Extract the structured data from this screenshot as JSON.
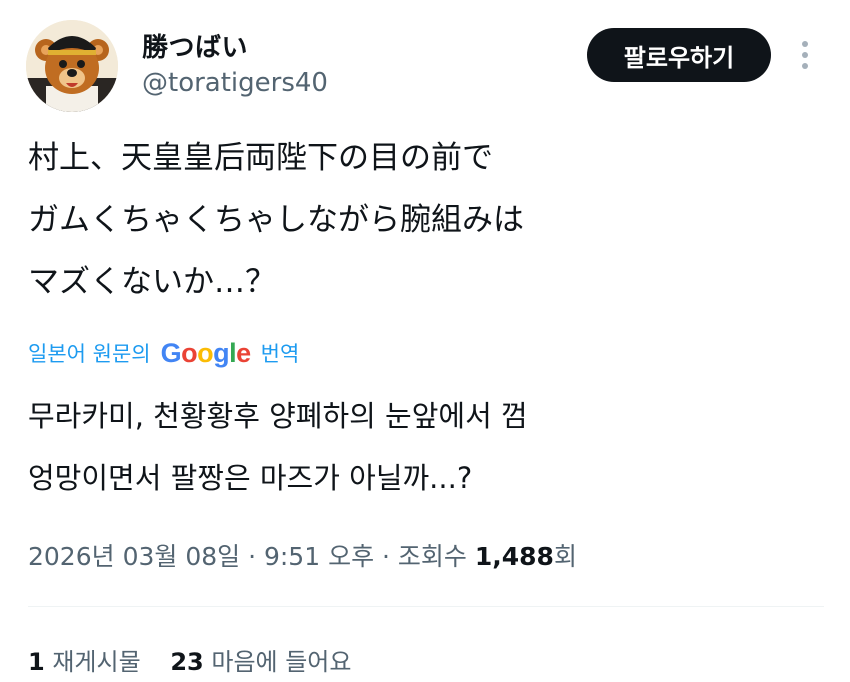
{
  "author": {
    "display_name": "勝つばい",
    "handle": "@toratigers40",
    "avatar": "bear-mascot-avatar"
  },
  "follow_label": "팔로우하기",
  "more_icon": "more-vertical-icon",
  "tweet": {
    "original_lines": [
      "村上、天皇皇后両陛下の目の前で",
      "ガムくちゃくちゃしながら腕組みは",
      "マズくないか…？"
    ],
    "translate_prefix": "일본어 원문의",
    "translate_google": "Google",
    "translate_suffix": "번역",
    "translated_lines": [
      "무라카미, 천황황후 양폐하의 눈앞에서 껌",
      "엉망이면서 팔짱은 마즈가 아닐까...?"
    ]
  },
  "meta": {
    "datetime": "2026년 03월 08일 · 9:51 오후 · 조회수 ",
    "views": "1,488",
    "views_suffix": "회"
  },
  "stats": {
    "reposts_count": "1",
    "reposts_label": "재게시물",
    "likes_count": "23",
    "likes_label": "마음에 들어요"
  },
  "colors": {
    "link_blue": "#1d9bf0",
    "muted": "#536471",
    "text": "#0f1419",
    "google_blue": "#4285f4",
    "google_red": "#ea4335",
    "google_yellow": "#fbbc05",
    "google_green": "#34a853"
  }
}
